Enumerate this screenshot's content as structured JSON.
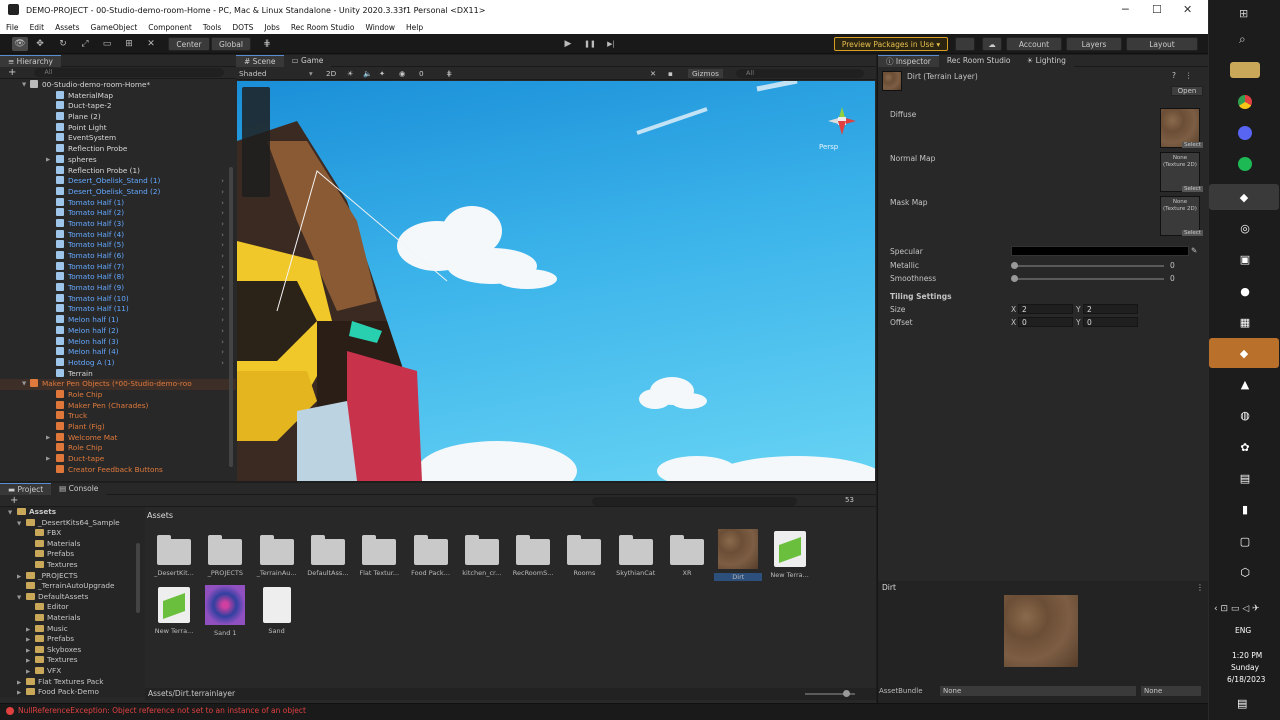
{
  "window": {
    "title": "DEMO-PROJECT - 00-Studio-demo-room-Home - PC, Mac & Linux Standalone - Unity 2020.3.33f1 Personal <DX11>",
    "minimize": "─",
    "maximize": "☐",
    "close": "✕"
  },
  "menu": [
    "File",
    "Edit",
    "Assets",
    "GameObject",
    "Component",
    "Tools",
    "DOTS",
    "Jobs",
    "Rec Room Studio",
    "Window",
    "Help"
  ],
  "toolbar": {
    "center": "Center",
    "global": "Global",
    "preview": "Preview Packages in Use",
    "preview_caret": "▾",
    "account": "Account",
    "layers": "Layers",
    "layout": "Layout",
    "play": "▶",
    "pause": "❚❚",
    "step": "▶|"
  },
  "hierarchy": {
    "tab": "Hierarchy",
    "search_placeholder": "All",
    "add": "+",
    "items": [
      {
        "label": "00-Studio-demo-room-Home*",
        "color": "white",
        "indent": 0,
        "icon": "scene-icon",
        "arrow": "▼"
      },
      {
        "label": "MaterialMap",
        "color": "white",
        "indent": 2,
        "icon": "cube"
      },
      {
        "label": "Duct-tape-2",
        "color": "white",
        "indent": 2,
        "icon": "cube"
      },
      {
        "label": "Plane (2)",
        "color": "white",
        "indent": 2,
        "icon": "cube"
      },
      {
        "label": "Point Light",
        "color": "white",
        "indent": 2,
        "icon": "cube"
      },
      {
        "label": "EventSystem",
        "color": "white",
        "indent": 2,
        "icon": "cube"
      },
      {
        "label": "Reflection Probe",
        "color": "white",
        "indent": 2,
        "icon": "cube"
      },
      {
        "label": "spheres",
        "color": "white",
        "indent": 2,
        "icon": "cube",
        "arrow": "▶"
      },
      {
        "label": "Reflection Probe (1)",
        "color": "white",
        "indent": 2,
        "icon": "cube"
      },
      {
        "label": "Desert_Obelisk_Stand (1)",
        "color": "blue",
        "indent": 2,
        "icon": "cube",
        "more": "›"
      },
      {
        "label": "Desert_Obelisk_Stand (2)",
        "color": "blue",
        "indent": 2,
        "icon": "cube",
        "more": "›"
      },
      {
        "label": "Tomato Half (1)",
        "color": "blue",
        "indent": 2,
        "icon": "cube",
        "more": "›"
      },
      {
        "label": "Tomato Half (2)",
        "color": "blue",
        "indent": 2,
        "icon": "cube",
        "more": "›"
      },
      {
        "label": "Tomato Half (3)",
        "color": "blue",
        "indent": 2,
        "icon": "cube",
        "more": "›"
      },
      {
        "label": "Tomato Half (4)",
        "color": "blue",
        "indent": 2,
        "icon": "cube",
        "more": "›"
      },
      {
        "label": "Tomato Half (5)",
        "color": "blue",
        "indent": 2,
        "icon": "cube",
        "more": "›"
      },
      {
        "label": "Tomato Half (6)",
        "color": "blue",
        "indent": 2,
        "icon": "cube",
        "more": "›"
      },
      {
        "label": "Tomato Half (7)",
        "color": "blue",
        "indent": 2,
        "icon": "cube",
        "more": "›"
      },
      {
        "label": "Tomato Half (8)",
        "color": "blue",
        "indent": 2,
        "icon": "cube",
        "more": "›"
      },
      {
        "label": "Tomato Half (9)",
        "color": "blue",
        "indent": 2,
        "icon": "cube",
        "more": "›"
      },
      {
        "label": "Tomato Half (10)",
        "color": "blue",
        "indent": 2,
        "icon": "cube",
        "more": "›"
      },
      {
        "label": "Tomato Half (11)",
        "color": "blue",
        "indent": 2,
        "icon": "cube",
        "more": "›"
      },
      {
        "label": "Melon half (1)",
        "color": "blue",
        "indent": 2,
        "icon": "cube",
        "more": "›"
      },
      {
        "label": "Melon half (2)",
        "color": "blue",
        "indent": 2,
        "icon": "cube",
        "more": "›"
      },
      {
        "label": "Melon half (3)",
        "color": "blue",
        "indent": 2,
        "icon": "cube",
        "more": "›"
      },
      {
        "label": "Melon half (4)",
        "color": "blue",
        "indent": 2,
        "icon": "cube",
        "more": "›"
      },
      {
        "label": "Hotdog A (1)",
        "color": "blue",
        "indent": 2,
        "icon": "cube",
        "more": "›"
      },
      {
        "label": "Terrain",
        "color": "white",
        "indent": 2,
        "icon": "cube"
      },
      {
        "label": "Maker Pen Objects (*00-Studio-demo-roo",
        "color": "orange",
        "indent": 0,
        "icon": "scene-icon",
        "arrow": "▼",
        "selected": true
      },
      {
        "label": "Role Chip",
        "color": "orange",
        "indent": 2,
        "icon": "ocube"
      },
      {
        "label": "Maker Pen (Charades)",
        "color": "orange",
        "indent": 2,
        "icon": "ocube"
      },
      {
        "label": "Truck",
        "color": "orange",
        "indent": 2,
        "icon": "ocube"
      },
      {
        "label": "Plant (Fig)",
        "color": "orange",
        "indent": 2,
        "icon": "ocube"
      },
      {
        "label": "Welcome Mat",
        "color": "orange",
        "indent": 2,
        "icon": "ocube",
        "arrow": "▶"
      },
      {
        "label": "Role Chip",
        "color": "orange",
        "indent": 2,
        "icon": "ocube"
      },
      {
        "label": "Duct-tape",
        "color": "orange",
        "indent": 2,
        "icon": "ocube",
        "arrow": "▶"
      },
      {
        "label": "Creator Feedback Buttons",
        "color": "orange",
        "indent": 2,
        "icon": "ocube"
      }
    ]
  },
  "scene": {
    "tab_scene": "Scene",
    "tab_game": "Game",
    "shading": "Shaded",
    "mode_2d": "2D",
    "gizmos": "Gizmos",
    "search_placeholder": "All",
    "layer_count": "0",
    "persp": "Persp"
  },
  "inspector": {
    "tab": "Inspector",
    "tab_recroom": "Rec Room Studio",
    "tab_lighting": "Lighting",
    "object_name": "Dirt (Terrain Layer)",
    "open": "Open",
    "diffuse": "Diffuse",
    "normal_map": "Normal Map",
    "mask_map": "Mask Map",
    "select": "Select",
    "none_tex": "None\n(Texture 2D)",
    "specular": "Specular",
    "metallic": "Metallic",
    "metallic_value": "0",
    "smoothness": "Smoothness",
    "smoothness_value": "0",
    "tiling_settings": "Tiling Settings",
    "size": "Size",
    "offset": "Offset",
    "size_x": "2",
    "size_y": "2",
    "offset_x": "0",
    "offset_y": "0",
    "x": "X",
    "y": "Y",
    "preview_title": "Dirt",
    "assetbundle": "AssetBundle",
    "assetbundle_value": "None",
    "assetbundle_variant": "None"
  },
  "project": {
    "tab_project": "Project",
    "tab_console": "Console",
    "breadcrumb": "Assets",
    "count": "53",
    "path": "Assets/Dirt.terrainlayer",
    "tree": [
      {
        "label": "Assets",
        "indent": 0,
        "arrow": "▼",
        "bold": true
      },
      {
        "label": "_DesertKits64_Sample",
        "indent": 1,
        "arrow": "▼"
      },
      {
        "label": "FBX",
        "indent": 2
      },
      {
        "label": "Materials",
        "indent": 2
      },
      {
        "label": "Prefabs",
        "indent": 2
      },
      {
        "label": "Textures",
        "indent": 2
      },
      {
        "label": "_PROJECTS",
        "indent": 1,
        "arrow": "▶"
      },
      {
        "label": "_TerrainAutoUpgrade",
        "indent": 1
      },
      {
        "label": "DefaultAssets",
        "indent": 1,
        "arrow": "▼"
      },
      {
        "label": "Editor",
        "indent": 2
      },
      {
        "label": "Materials",
        "indent": 2
      },
      {
        "label": "Music",
        "indent": 2,
        "arrow": "▶"
      },
      {
        "label": "Prefabs",
        "indent": 2,
        "arrow": "▶"
      },
      {
        "label": "Skyboxes",
        "indent": 2,
        "arrow": "▶"
      },
      {
        "label": "Textures",
        "indent": 2,
        "arrow": "▶"
      },
      {
        "label": "VFX",
        "indent": 2,
        "arrow": "▶"
      },
      {
        "label": "Flat Textures Pack",
        "indent": 1,
        "arrow": "▶"
      },
      {
        "label": "Food Pack-Demo",
        "indent": 1,
        "arrow": "▶"
      }
    ],
    "assets": [
      {
        "label": "_DesertKit...",
        "kind": "folder"
      },
      {
        "label": "_PROJECTS",
        "kind": "folder"
      },
      {
        "label": "_TerrainAu...",
        "kind": "folder"
      },
      {
        "label": "DefaultAss...",
        "kind": "folder"
      },
      {
        "label": "Flat Textur...",
        "kind": "folder"
      },
      {
        "label": "Food Pack...",
        "kind": "folder"
      },
      {
        "label": "kitchen_cr...",
        "kind": "folder"
      },
      {
        "label": "RecRoomS...",
        "kind": "folder"
      },
      {
        "label": "Rooms",
        "kind": "folder"
      },
      {
        "label": "SkythianCat",
        "kind": "folder"
      },
      {
        "label": "XR",
        "kind": "folder"
      },
      {
        "label": "Dirt",
        "kind": "dirt"
      },
      {
        "label": "New Terra...",
        "kind": "terrain"
      },
      {
        "label": "New Terra...",
        "kind": "terrain"
      },
      {
        "label": "Sand 1",
        "kind": "sand"
      },
      {
        "label": "Sand",
        "kind": "file"
      }
    ]
  },
  "status": {
    "error": "NullReferenceException: Object reference not set to an instance of an object"
  },
  "taskbar": {
    "lang": "ENG",
    "time": "1:20 PM",
    "day": "Sunday",
    "date": "6/18/2023"
  },
  "colors": {
    "accent_blue": "#5a8cd0",
    "preview_yellow": "#d8a020",
    "error_red": "#e04040",
    "prefab_blue": "#64a8ff",
    "orange": "#e07a3c",
    "sky": "#3bb3ea"
  }
}
